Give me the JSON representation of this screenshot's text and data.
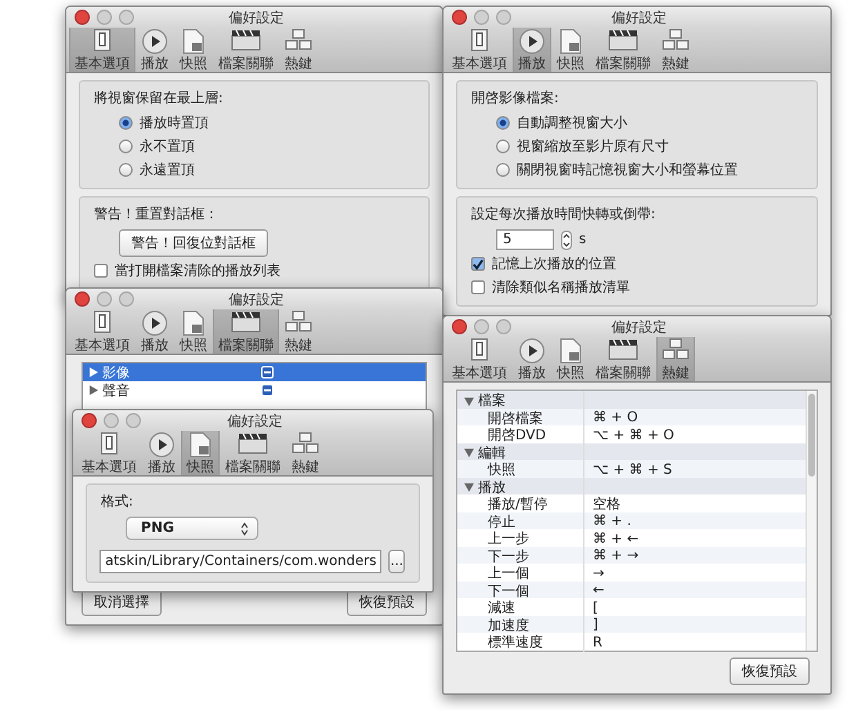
{
  "windows": [
    {
      "kind": "sections",
      "title": "偏好設定",
      "toolbar": [
        {
          "label": "基本選項",
          "selected": true
        },
        {
          "label": "播放",
          "selected": false
        },
        {
          "label": "快照",
          "selected": false
        },
        {
          "label": "檔案關聯",
          "selected": false
        },
        {
          "label": "熱鍵",
          "selected": false
        }
      ],
      "sections": [
        {
          "items": [
            {
              "kind": "heading",
              "text": "將視窗保留在最上層:"
            },
            {
              "kind": "radio",
              "label": "播放時置頂",
              "selected": true
            },
            {
              "kind": "radio",
              "label": "永不置頂",
              "selected": false
            },
            {
              "kind": "radio",
              "label": "永遠置頂",
              "selected": false
            }
          ]
        },
        {
          "items": [
            {
              "kind": "heading",
              "text": "警告！重置對話框："
            },
            {
              "kind": "button",
              "label": "警告！回復位對話框"
            },
            {
              "kind": "checkbox",
              "label": "當打開檔案清除的播放列表",
              "checked": false
            }
          ]
        }
      ]
    },
    {
      "kind": "sections",
      "title": "偏好設定",
      "toolbar": [
        {
          "label": "基本選項",
          "selected": false
        },
        {
          "label": "播放",
          "selected": true
        },
        {
          "label": "快照",
          "selected": false
        },
        {
          "label": "檔案關聯",
          "selected": false
        },
        {
          "label": "熱鍵",
          "selected": false
        }
      ],
      "sections": [
        {
          "items": [
            {
              "kind": "heading",
              "text": "開啓影像檔案:"
            },
            {
              "kind": "radio",
              "label": "自動調整視窗大小",
              "selected": true
            },
            {
              "kind": "radio",
              "label": "視窗縮放至影片原有尺寸",
              "selected": false
            },
            {
              "kind": "radio",
              "label": "關閉視窗時記憶視窗大小和螢幕位置",
              "selected": false
            }
          ]
        },
        {
          "items": [
            {
              "kind": "heading",
              "text": "設定每次播放時間快轉或倒帶:"
            },
            {
              "kind": "stepper",
              "value": "5",
              "unit": "s"
            },
            {
              "kind": "checkbox",
              "label": "記憶上次播放的位置",
              "checked": true
            },
            {
              "kind": "checkbox",
              "label": "清除類似名稱播放清單",
              "checked": false
            }
          ]
        }
      ]
    },
    {
      "kind": "list",
      "title": "偏好設定",
      "toolbar": [
        {
          "label": "基本選項",
          "selected": false
        },
        {
          "label": "播放",
          "selected": false
        },
        {
          "label": "快照",
          "selected": false
        },
        {
          "label": "檔案關聯",
          "selected": true
        },
        {
          "label": "熱鍵",
          "selected": false
        }
      ],
      "items": [
        {
          "label": "影像",
          "selected": true,
          "expanded": false
        },
        {
          "label": "聲音",
          "selected": false,
          "expanded": false
        }
      ],
      "buttons": [
        "取消選擇",
        "恢復預設"
      ]
    },
    {
      "kind": "hotkeys",
      "title": "偏好設定",
      "toolbar": [
        {
          "label": "基本選項",
          "selected": false
        },
        {
          "label": "播放",
          "selected": false
        },
        {
          "label": "快照",
          "selected": false
        },
        {
          "label": "檔案關聯",
          "selected": false
        },
        {
          "label": "熱鍵",
          "selected": true
        }
      ],
      "groups": [
        {
          "label": "檔案",
          "expanded": true,
          "children": [
            {
              "action": "開啓檔案",
              "shortcut": "⌘ + O"
            },
            {
              "action": "開啓DVD",
              "shortcut": "⌥ + ⌘ + O"
            }
          ]
        },
        {
          "label": "編輯",
          "expanded": true,
          "children": [
            {
              "action": "快照",
              "shortcut": "⌥ + ⌘ + S"
            }
          ]
        },
        {
          "label": "播放",
          "expanded": true,
          "children": [
            {
              "action": "播放/暫停",
              "shortcut": "空格"
            },
            {
              "action": "停止",
              "shortcut": "⌘ + ."
            },
            {
              "action": "上一步",
              "shortcut": "⌘ + ←"
            },
            {
              "action": "下一步",
              "shortcut": "⌘ + →"
            },
            {
              "action": "上一個",
              "shortcut": "→"
            },
            {
              "action": "下一個",
              "shortcut": "←"
            },
            {
              "action": "減速",
              "shortcut": "["
            },
            {
              "action": "加速度",
              "shortcut": "]"
            },
            {
              "action": "標準速度",
              "shortcut": "R"
            }
          ]
        }
      ],
      "buttons": [
        "恢復預設"
      ]
    },
    {
      "kind": "sections",
      "title": "偏好設定",
      "toolbar": [
        {
          "label": "基本選項",
          "selected": false
        },
        {
          "label": "播放",
          "selected": false
        },
        {
          "label": "快照",
          "selected": true
        },
        {
          "label": "檔案關聯",
          "selected": false
        },
        {
          "label": "熱鍵",
          "selected": false
        }
      ],
      "sections": [
        {
          "items": [
            {
              "kind": "heading",
              "text": "格式:"
            },
            {
              "kind": "popup",
              "value": "PNG"
            },
            {
              "kind": "path",
              "value": "atskin/Library/Containers/com.wonders",
              "button": "..."
            }
          ]
        }
      ]
    }
  ]
}
